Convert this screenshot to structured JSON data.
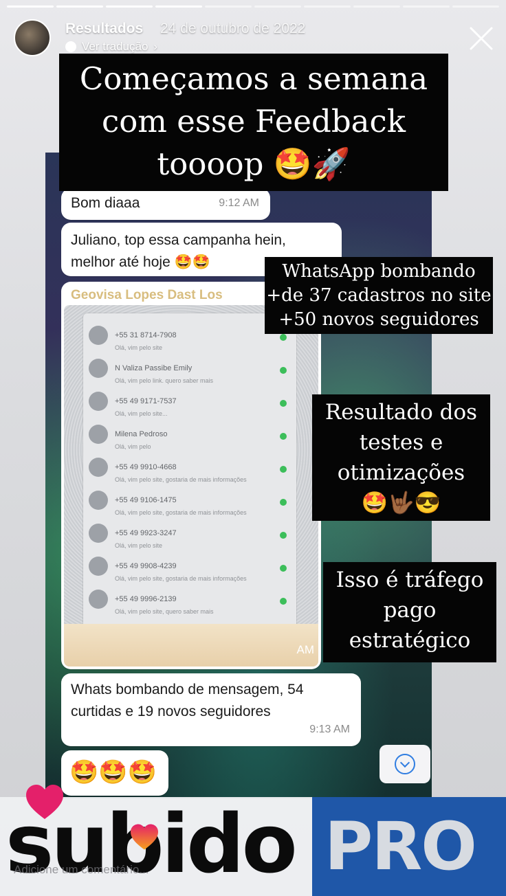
{
  "header": {
    "account_name": "Resultados",
    "date": "24 de outubro de 2022",
    "translate_label": "Ver tradução"
  },
  "overlays": {
    "title_lines": [
      "Começamos a semana",
      "com esse Feedback",
      "toooop 🤩🚀"
    ],
    "box2_lines": [
      "WhatsApp bombando",
      "+de 37 cadastros no site",
      "+50 novos seguidores"
    ],
    "box3_lines": [
      "Resultado dos",
      "testes e",
      "otimizações",
      "🤩🤟🏾😎"
    ],
    "box4_lines": [
      "Isso é tráfego",
      "pago",
      "estratégico"
    ]
  },
  "chat": {
    "messages": [
      {
        "text": "Bom diaaa",
        "time": "9:12 AM"
      },
      {
        "text_lines": [
          "Juliano, top essa campanha hein,",
          "melhor até hoje 🤩🤩"
        ]
      },
      {
        "forwarded_label": "Geovisa Lopes Dast Los",
        "time_partial": "AM"
      },
      {
        "text_lines": [
          "Whats bombando de mensagem, 54",
          "curtidas e 19 novos seguidores"
        ],
        "time": "9:13 AM"
      },
      {
        "text": "🤩🤩🤩"
      }
    ],
    "photo_rows": [
      {
        "name": "+55 31 8714-7908",
        "preview": "Olá, vim pelo site"
      },
      {
        "name": "N Valiza Passibe Emily",
        "preview": "Olá, vim pelo link. quero saber mais"
      },
      {
        "name": "+55 49 9171-7537",
        "preview": "Olá, vim pelo site..."
      },
      {
        "name": "Milena Pedroso",
        "preview": "Olá, vim pelo"
      },
      {
        "name": "+55 49 9910-4668",
        "preview": "Olá, vim pelo site, gostaria de mais informações"
      },
      {
        "name": "+55 49 9106-1475",
        "preview": "Olá, vim pelo site, gostaria de mais informações"
      },
      {
        "name": "+55 49 9923-3247",
        "preview": "Olá, vim pelo site"
      },
      {
        "name": "+55 49 9908-4239",
        "preview": "Olá, vim pelo site, gostaria de mais informações"
      },
      {
        "name": "+55 49 9996-2139",
        "preview": "Olá, vim pelo site, quero saber mais"
      }
    ]
  },
  "branding": {
    "left_word": "subido",
    "right_word": "PRO"
  },
  "footer": {
    "comment_placeholder": "Adicione um comentário..."
  },
  "colors": {
    "overlay_box": "#050505",
    "bubble": "#ffffff",
    "pro_badge": "#1f57a8",
    "heart": "#e4206a"
  }
}
